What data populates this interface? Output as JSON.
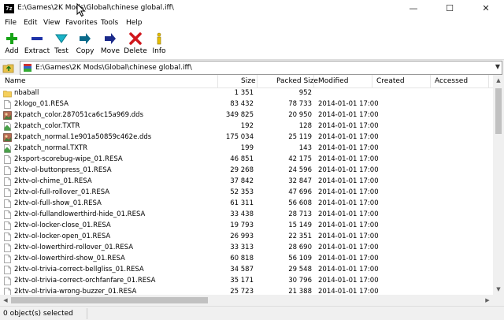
{
  "window": {
    "app_icon_text": "7z",
    "title": "E:\\Games\\2K Mods\\Global\\chinese global.iff\\",
    "minimize": "—",
    "maximize": "☐",
    "close": "✕"
  },
  "menu": [
    {
      "label": "File",
      "name": "menu-file"
    },
    {
      "label": "Edit",
      "name": "menu-edit"
    },
    {
      "label": "View",
      "name": "menu-view"
    },
    {
      "label": "Favorites",
      "name": "menu-favorites"
    },
    {
      "label": "Tools",
      "name": "menu-tools"
    },
    {
      "label": "Help",
      "name": "menu-help"
    }
  ],
  "toolbar": [
    {
      "label": "Add",
      "icon": "add-icon",
      "color": "#17a317"
    },
    {
      "label": "Extract",
      "icon": "extract-icon",
      "color": "#1f33a8"
    },
    {
      "label": "Test",
      "icon": "test-icon",
      "color": "#1bb3c8"
    },
    {
      "label": "Copy",
      "icon": "copy-icon",
      "color": "#0a6a8a"
    },
    {
      "label": "Move",
      "icon": "move-icon",
      "color": "#1b2a8a"
    },
    {
      "label": "Delete",
      "icon": "delete-icon",
      "color": "#d0161c"
    },
    {
      "label": "Info",
      "icon": "info-icon",
      "color": "#e8c000"
    }
  ],
  "address": {
    "path": "E:\\Games\\2K Mods\\Global\\chinese global.iff\\"
  },
  "columns": {
    "name": "Name",
    "size": "Size",
    "packed": "Packed Size",
    "modified": "Modified",
    "created": "Created",
    "accessed": "Accessed"
  },
  "files": [
    {
      "name": "nbaball",
      "size": "1 351",
      "packed": "952",
      "modified": "",
      "icon": "folder-icon"
    },
    {
      "name": "2klogo_01.RESA",
      "size": "83 432",
      "packed": "78 733",
      "modified": "2014-01-01 17:00",
      "icon": "file-icon"
    },
    {
      "name": "2kpatch_color.287051ca6c15a969.dds",
      "size": "349 825",
      "packed": "20 950",
      "modified": "2014-01-01 17:00",
      "icon": "image-file-icon"
    },
    {
      "name": "2kpatch_color.TXTR",
      "size": "192",
      "packed": "128",
      "modified": "2014-01-01 17:00",
      "icon": "texture-file-icon"
    },
    {
      "name": "2kpatch_normal.1e901a50859c462e.dds",
      "size": "175 034",
      "packed": "25 119",
      "modified": "2014-01-01 17:00",
      "icon": "image-file-icon"
    },
    {
      "name": "2kpatch_normal.TXTR",
      "size": "199",
      "packed": "143",
      "modified": "2014-01-01 17:00",
      "icon": "texture-file-icon"
    },
    {
      "name": "2ksport-scorebug-wipe_01.RESA",
      "size": "46 851",
      "packed": "42 175",
      "modified": "2014-01-01 17:00",
      "icon": "file-icon"
    },
    {
      "name": "2ktv-ol-buttonpress_01.RESA",
      "size": "29 268",
      "packed": "24 596",
      "modified": "2014-01-01 17:00",
      "icon": "file-icon"
    },
    {
      "name": "2ktv-ol-chime_01.RESA",
      "size": "37 842",
      "packed": "32 847",
      "modified": "2014-01-01 17:00",
      "icon": "file-icon"
    },
    {
      "name": "2ktv-ol-full-rollover_01.RESA",
      "size": "52 353",
      "packed": "47 696",
      "modified": "2014-01-01 17:00",
      "icon": "file-icon"
    },
    {
      "name": "2ktv-ol-full-show_01.RESA",
      "size": "61 311",
      "packed": "56 608",
      "modified": "2014-01-01 17:00",
      "icon": "file-icon"
    },
    {
      "name": "2ktv-ol-fullandlowerthird-hide_01.RESA",
      "size": "33 438",
      "packed": "28 713",
      "modified": "2014-01-01 17:00",
      "icon": "file-icon"
    },
    {
      "name": "2ktv-ol-locker-close_01.RESA",
      "size": "19 793",
      "packed": "15 149",
      "modified": "2014-01-01 17:00",
      "icon": "file-icon"
    },
    {
      "name": "2ktv-ol-locker-open_01.RESA",
      "size": "26 993",
      "packed": "22 351",
      "modified": "2014-01-01 17:00",
      "icon": "file-icon"
    },
    {
      "name": "2ktv-ol-lowerthird-rollover_01.RESA",
      "size": "33 313",
      "packed": "28 690",
      "modified": "2014-01-01 17:00",
      "icon": "file-icon"
    },
    {
      "name": "2ktv-ol-lowerthird-show_01.RESA",
      "size": "60 818",
      "packed": "56 109",
      "modified": "2014-01-01 17:00",
      "icon": "file-icon"
    },
    {
      "name": "2ktv-ol-trivia-correct-bellgliss_01.RESA",
      "size": "34 587",
      "packed": "29 548",
      "modified": "2014-01-01 17:00",
      "icon": "file-icon"
    },
    {
      "name": "2ktv-ol-trivia-correct-orchfanfare_01.RESA",
      "size": "35 171",
      "packed": "30 796",
      "modified": "2014-01-01 17:00",
      "icon": "file-icon"
    },
    {
      "name": "2ktv-ol-trivia-wrong-buzzer_01.RESA",
      "size": "25 723",
      "packed": "21 388",
      "modified": "2014-01-01 17:00",
      "icon": "file-icon"
    }
  ],
  "status": {
    "selection": "0 object(s) selected"
  }
}
